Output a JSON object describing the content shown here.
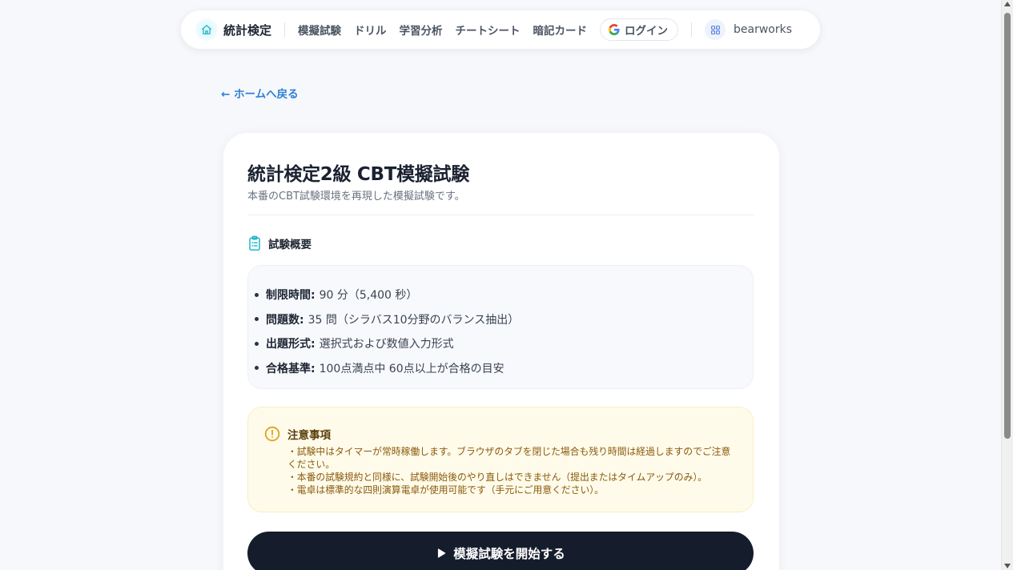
{
  "nav": {
    "brand": "統計検定",
    "links": [
      "模擬試験",
      "ドリル",
      "学習分析",
      "チートシート",
      "暗記カード"
    ],
    "login_label": "ログイン",
    "account_name": "bearworks",
    "accent_color": "#1fb6c9"
  },
  "back_link": "← ホームへ戻る",
  "card": {
    "title": "統計検定2級 CBT模擬試験",
    "subtitle": "本番のCBT試験環境を再現した模擬試験です。",
    "overview_title": "試験概要",
    "overview_items": [
      {
        "label": "制限時間:",
        "value": "90 分（5,400 秒）"
      },
      {
        "label": "問題数:",
        "value": "35 問（シラバス10分野のバランス抽出）"
      },
      {
        "label": "出題形式:",
        "value": "選択式および数値入力形式"
      },
      {
        "label": "合格基準:",
        "value": "100点満点中 60点以上が合格の目安"
      }
    ],
    "notice_title": "注意事項",
    "notice_lines": [
      "・試験中はタイマーが常時稼働します。ブラウザのタブを閉じた場合も残り時間は経過しますのでご注意",
      "ください。",
      "・本番の試験規約と同様に、試験開始後のやり直しはできません（提出またはタイムアップのみ）。",
      "・電卓は標準的な四則演算電卓が使用可能です（手元にご用意ください）。"
    ],
    "start_button": "模擬試験を開始する"
  }
}
